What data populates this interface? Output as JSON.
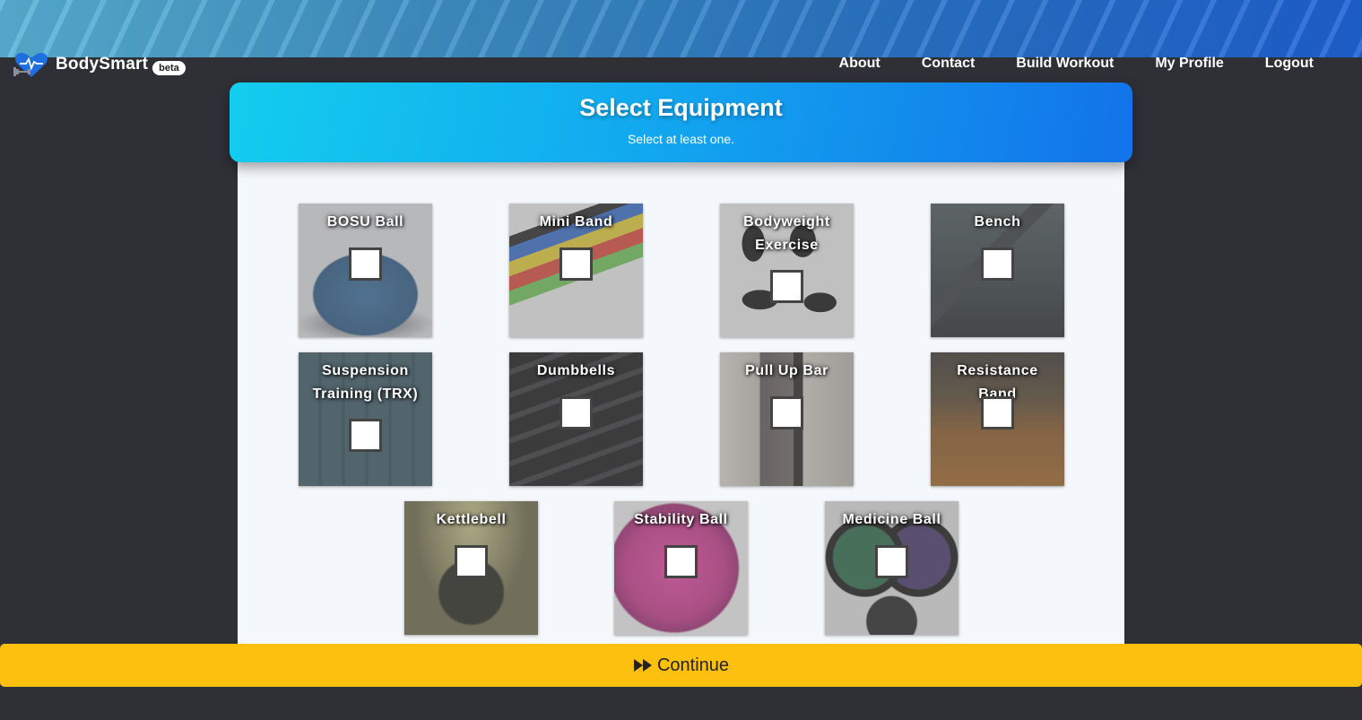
{
  "brand": {
    "name": "BodySmart",
    "badge": "beta"
  },
  "nav": {
    "links": [
      "About",
      "Contact",
      "Build Workout",
      "My Profile",
      "Logout"
    ]
  },
  "header": {
    "title": "Select Equipment",
    "subtitle": "Select at least one."
  },
  "equipment": [
    {
      "label": "BOSU Ball",
      "checked": false
    },
    {
      "label": "Mini Band",
      "checked": false
    },
    {
      "label": "Bodyweight Exercise",
      "checked": false
    },
    {
      "label": "Bench",
      "checked": false
    },
    {
      "label": "Suspension Training (TRX)",
      "checked": false
    },
    {
      "label": "Dumbbells",
      "checked": false
    },
    {
      "label": "Pull Up Bar",
      "checked": false
    },
    {
      "label": "Resistance Band",
      "checked": false
    },
    {
      "label": "Kettlebell",
      "checked": false
    },
    {
      "label": "Stability Ball",
      "checked": false
    },
    {
      "label": "Medicine Ball",
      "checked": false
    }
  ],
  "continue_button": {
    "label": "Continue",
    "icon": "fast-forward-icon"
  },
  "colors": {
    "accent": "#fdc00f",
    "header_start": "#13cdee",
    "header_end": "#1273ea",
    "background": "#2f2f36"
  }
}
